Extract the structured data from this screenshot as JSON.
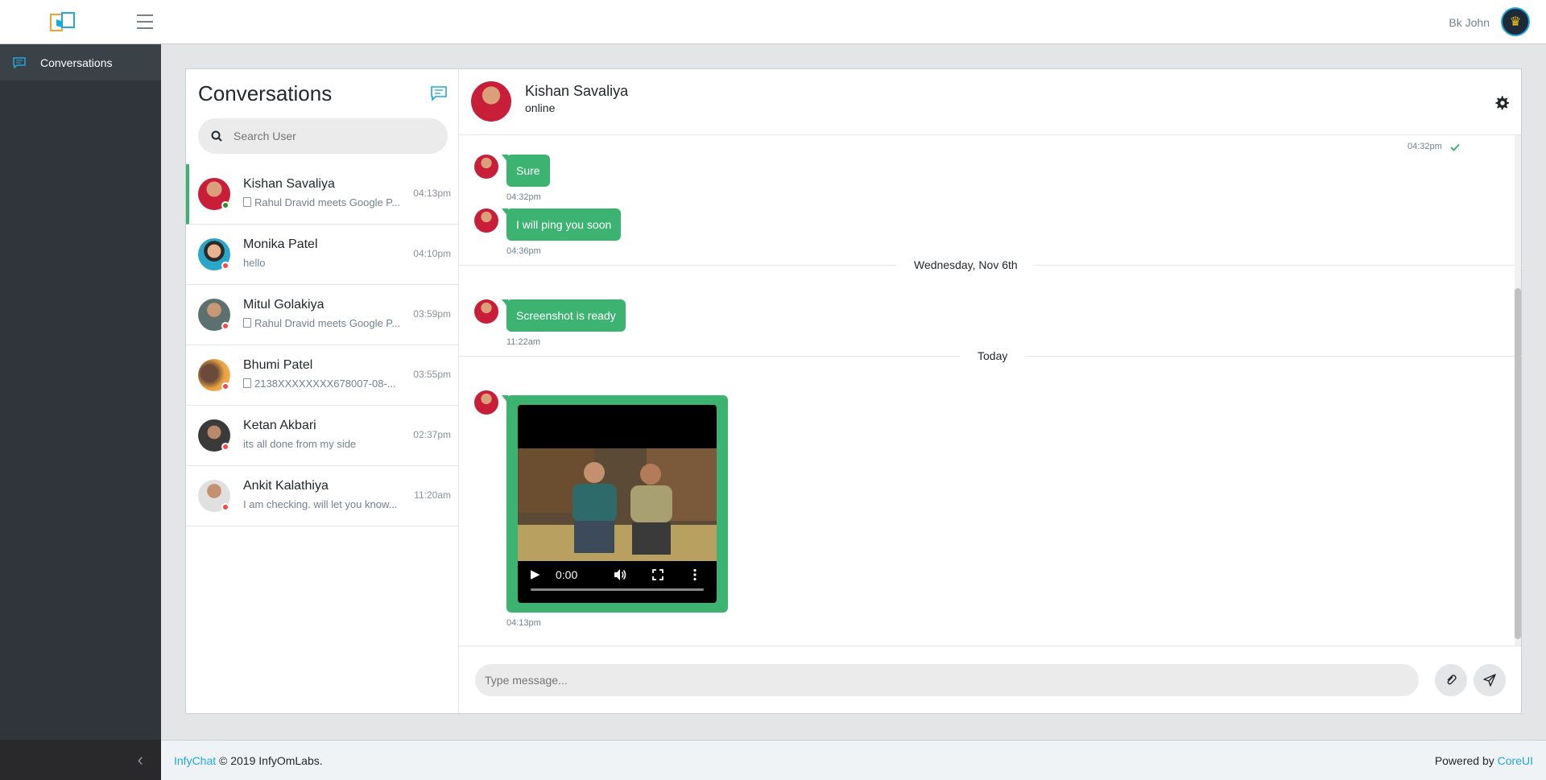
{
  "header": {
    "user_name": "Bk John"
  },
  "sidebar": {
    "items": [
      {
        "label": "Conversations",
        "icon": "chat-icon"
      }
    ],
    "minimizer_icon": "chevron-left-icon"
  },
  "conversations": {
    "title": "Conversations",
    "search_placeholder": "Search User",
    "items": [
      {
        "name": "Kishan Savaliya",
        "preview": "Rahul Dravid meets Google P...",
        "time": "04:13pm",
        "status": "online",
        "has_file": true,
        "avatar_color": "#c81e3a"
      },
      {
        "name": "Monika Patel",
        "preview": "hello",
        "time": "04:10pm",
        "status": "offline",
        "has_file": false,
        "avatar_color": "#2aa6c9"
      },
      {
        "name": "Mitul Golakiya",
        "preview": "Rahul Dravid meets Google P...",
        "time": "03:59pm",
        "status": "offline",
        "has_file": true,
        "avatar_color": "#6b7a7a"
      },
      {
        "name": "Bhumi Patel",
        "preview": "2138XXXXXXXX678007-08-...",
        "time": "03:55pm",
        "status": "offline",
        "has_file": true,
        "avatar_color": "#c97a2a"
      },
      {
        "name": "Ketan Akbari",
        "preview": "its all done from my side",
        "time": "02:37pm",
        "status": "offline",
        "has_file": false,
        "avatar_color": "#4a4a4a"
      },
      {
        "name": "Ankit Kalathiya",
        "preview": "I am checking. will let you know...",
        "time": "11:20am",
        "status": "offline",
        "has_file": false,
        "avatar_color": "#8a6a52"
      }
    ]
  },
  "chat": {
    "name": "Kishan Savaliya",
    "status": "online",
    "top_time": "04:32pm",
    "messages": [
      {
        "text": "Sure",
        "time": "04:32pm"
      },
      {
        "text": "I will ping you soon",
        "time": "04:36pm"
      },
      {
        "text": "Screenshot is ready",
        "time": "11:22am"
      }
    ],
    "dates": [
      "Wednesday, Nov 6th",
      "Today"
    ],
    "video": {
      "time": "0:00",
      "sent_time": "04:13pm"
    },
    "composer_placeholder": "Type message..."
  },
  "footer": {
    "brand": "InfyChat",
    "copyright": "© 2019 InfyOmLabs.",
    "powered_by": "Powered by",
    "powered_link": "CoreUI"
  },
  "colors": {
    "accent": "#3cb371",
    "link": "#20a8d8",
    "sidebar": "#2f353a",
    "online": "#2e8b2e",
    "offline": "#f04b4b"
  }
}
